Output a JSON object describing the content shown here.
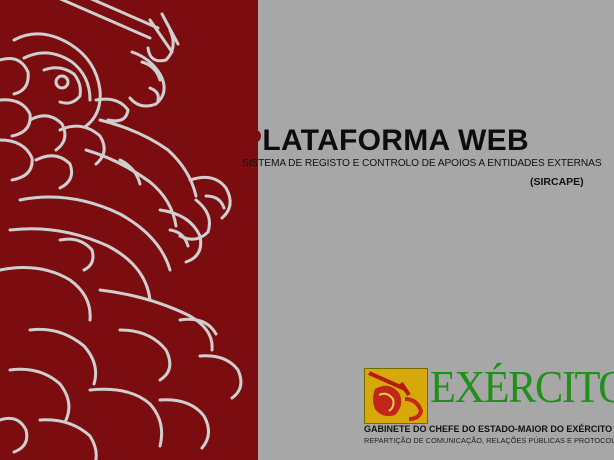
{
  "slide": {
    "title_initial": "P",
    "title_rest": "LATAFORMA WEB",
    "subtitle": "SISTEMA DE REGISTO E CONTROLO DE APOIOS A ENTIDADES EXTERNAS",
    "acronym": "(SIRCAPE)"
  },
  "branding": {
    "wordmark": "EXÉRCITO",
    "office": "GABINETE DO CHEFE DO ESTADO-MAIOR DO EXÉRCITO",
    "department": "REPARTIÇÃO DE COMUNICAÇÃO, RELAÇÕES PÚBLICAS E PROTOCOLO",
    "emblem_icon": "lion-sword-emblem-icon"
  },
  "colors": {
    "left_panel": "#7b0d10",
    "right_panel": "#a7a7a7",
    "title_accent": "#7b0d10",
    "wordmark": "#20901a",
    "emblem_background": "#d6a80a"
  },
  "decorative": {
    "left_art_icon": "heraldic-lion-with-sword-icon"
  }
}
